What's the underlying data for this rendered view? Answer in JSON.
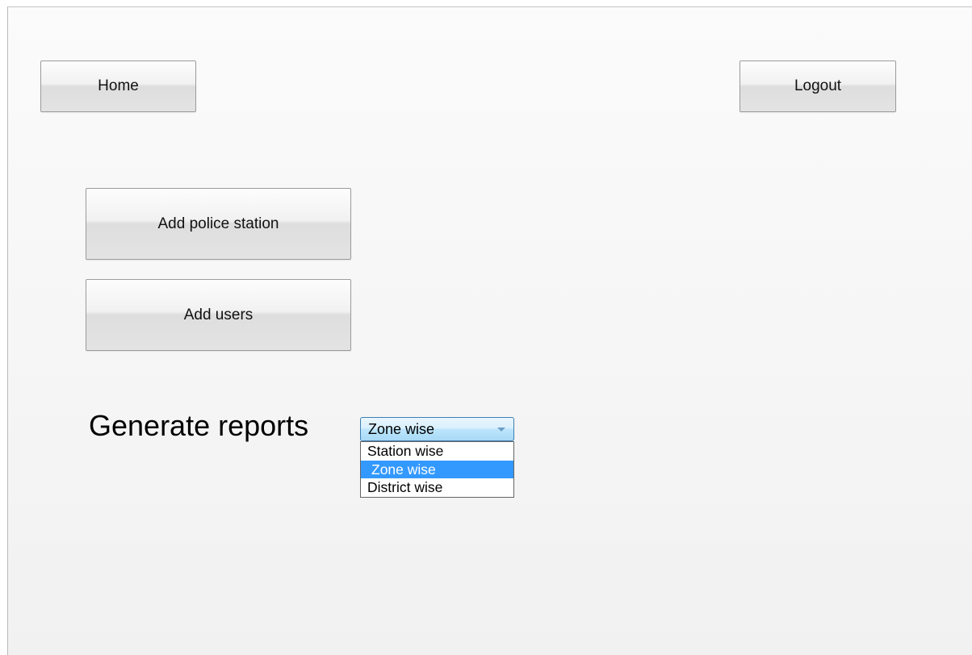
{
  "header": {
    "home_label": "Home",
    "logout_label": "Logout"
  },
  "actions": {
    "add_police_station_label": "Add police station",
    "add_users_label": "Add users"
  },
  "reports": {
    "label": "Generate reports",
    "select": {
      "selected_value": "Zone wise",
      "options": [
        {
          "label": "Station wise",
          "selected": false
        },
        {
          "label": "Zone wise",
          "selected": true
        },
        {
          "label": "District wise",
          "selected": false
        }
      ],
      "expanded": true
    }
  },
  "colors": {
    "selection_highlight": "#3399ff",
    "select_border": "#3c7fb1",
    "button_border": "#9c9c9c"
  }
}
